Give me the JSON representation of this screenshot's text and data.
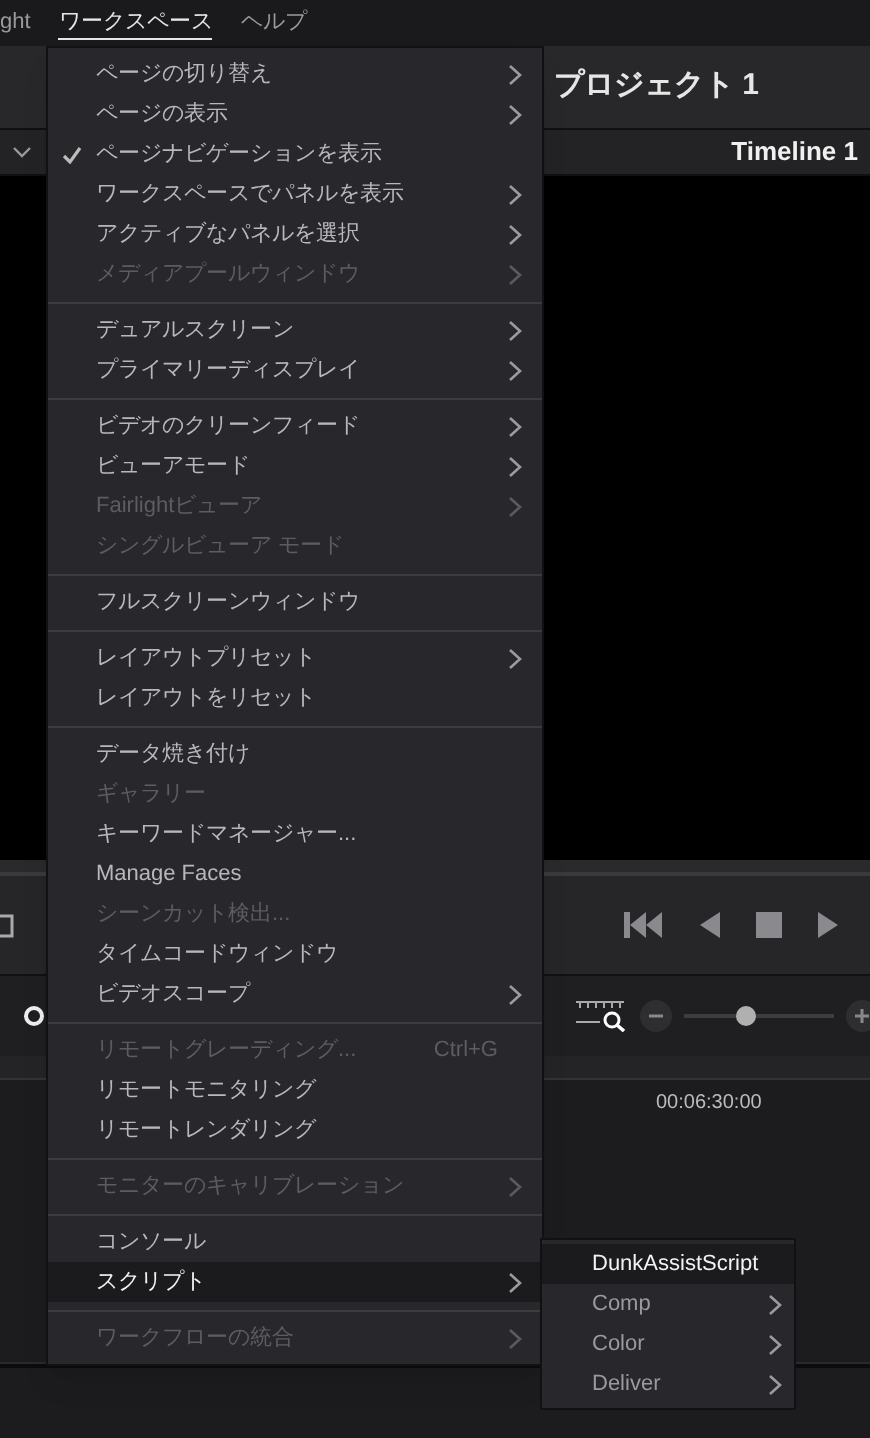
{
  "menubar": [
    {
      "label": "ght",
      "selected": false
    },
    {
      "label": "ワークスペース",
      "selected": true
    },
    {
      "label": "ヘルプ",
      "selected": false
    }
  ],
  "project_title": "プロジェクト 1",
  "timeline_name": "Timeline 1",
  "timecode": "00:06:30:00",
  "zoom_slider": {
    "level": 0.42
  },
  "menu": [
    {
      "kind": "item",
      "label": "ページの切り替え",
      "submenu": true,
      "disabled": false,
      "checked": false,
      "selected": false
    },
    {
      "kind": "item",
      "label": "ページの表示",
      "submenu": true,
      "disabled": false,
      "checked": false,
      "selected": false
    },
    {
      "kind": "item",
      "label": "ページナビゲーションを表示",
      "submenu": false,
      "disabled": false,
      "checked": true,
      "selected": false
    },
    {
      "kind": "item",
      "label": "ワークスペースでパネルを表示",
      "submenu": true,
      "disabled": false,
      "checked": false,
      "selected": false
    },
    {
      "kind": "item",
      "label": "アクティブなパネルを選択",
      "submenu": true,
      "disabled": false,
      "checked": false,
      "selected": false
    },
    {
      "kind": "item",
      "label": "メディアプールウィンドウ",
      "submenu": true,
      "disabled": true,
      "checked": false,
      "selected": false
    },
    {
      "kind": "separator"
    },
    {
      "kind": "item",
      "label": "デュアルスクリーン",
      "submenu": true,
      "disabled": false,
      "checked": false,
      "selected": false
    },
    {
      "kind": "item",
      "label": "プライマリーディスプレイ",
      "submenu": true,
      "disabled": false,
      "checked": false,
      "selected": false
    },
    {
      "kind": "separator"
    },
    {
      "kind": "item",
      "label": "ビデオのクリーンフィード",
      "submenu": true,
      "disabled": false,
      "checked": false,
      "selected": false
    },
    {
      "kind": "item",
      "label": "ビューアモード",
      "submenu": true,
      "disabled": false,
      "checked": false,
      "selected": false
    },
    {
      "kind": "item",
      "label": "Fairlightビューア",
      "submenu": true,
      "disabled": true,
      "checked": false,
      "selected": false
    },
    {
      "kind": "item",
      "label": "シングルビューア モード",
      "submenu": false,
      "disabled": true,
      "checked": false,
      "selected": false
    },
    {
      "kind": "separator"
    },
    {
      "kind": "item",
      "label": "フルスクリーンウィンドウ",
      "submenu": false,
      "disabled": false,
      "checked": false,
      "selected": false
    },
    {
      "kind": "separator"
    },
    {
      "kind": "item",
      "label": "レイアウトプリセット",
      "submenu": true,
      "disabled": false,
      "checked": false,
      "selected": false
    },
    {
      "kind": "item",
      "label": "レイアウトをリセット",
      "submenu": false,
      "disabled": false,
      "checked": false,
      "selected": false
    },
    {
      "kind": "separator"
    },
    {
      "kind": "item",
      "label": "データ焼き付け",
      "submenu": false,
      "disabled": false,
      "checked": false,
      "selected": false
    },
    {
      "kind": "item",
      "label": "ギャラリー",
      "submenu": false,
      "disabled": true,
      "checked": false,
      "selected": false
    },
    {
      "kind": "item",
      "label": "キーワードマネージャー...",
      "submenu": false,
      "disabled": false,
      "checked": false,
      "selected": false
    },
    {
      "kind": "item",
      "label": "Manage Faces",
      "submenu": false,
      "disabled": false,
      "checked": false,
      "selected": false
    },
    {
      "kind": "item",
      "label": "シーンカット検出...",
      "submenu": false,
      "disabled": true,
      "checked": false,
      "selected": false
    },
    {
      "kind": "item",
      "label": "タイムコードウィンドウ",
      "submenu": false,
      "disabled": false,
      "checked": false,
      "selected": false
    },
    {
      "kind": "item",
      "label": "ビデオスコープ",
      "submenu": true,
      "disabled": false,
      "checked": false,
      "selected": false
    },
    {
      "kind": "separator"
    },
    {
      "kind": "item",
      "label": "リモートグレーディング...",
      "shortcut": "Ctrl+G",
      "submenu": false,
      "disabled": true,
      "checked": false,
      "selected": false
    },
    {
      "kind": "item",
      "label": "リモートモニタリング",
      "submenu": false,
      "disabled": false,
      "checked": false,
      "selected": false
    },
    {
      "kind": "item",
      "label": "リモートレンダリング",
      "submenu": false,
      "disabled": false,
      "checked": false,
      "selected": false
    },
    {
      "kind": "separator"
    },
    {
      "kind": "item",
      "label": "モニターのキャリブレーション",
      "submenu": true,
      "disabled": true,
      "checked": false,
      "selected": false
    },
    {
      "kind": "separator"
    },
    {
      "kind": "item",
      "label": "コンソール",
      "submenu": false,
      "disabled": false,
      "checked": false,
      "selected": false
    },
    {
      "kind": "item",
      "label": "スクリプト",
      "submenu": true,
      "disabled": false,
      "checked": false,
      "selected": true
    },
    {
      "kind": "separator"
    },
    {
      "kind": "item",
      "label": "ワークフローの統合",
      "submenu": true,
      "disabled": true,
      "checked": false,
      "selected": false
    }
  ],
  "submenu": [
    {
      "label": "DunkAssistScript",
      "submenu": false,
      "selected": true
    },
    {
      "label": "Comp",
      "submenu": true,
      "selected": false
    },
    {
      "label": "Color",
      "submenu": true,
      "selected": false
    },
    {
      "label": "Deliver",
      "submenu": true,
      "selected": false
    }
  ]
}
